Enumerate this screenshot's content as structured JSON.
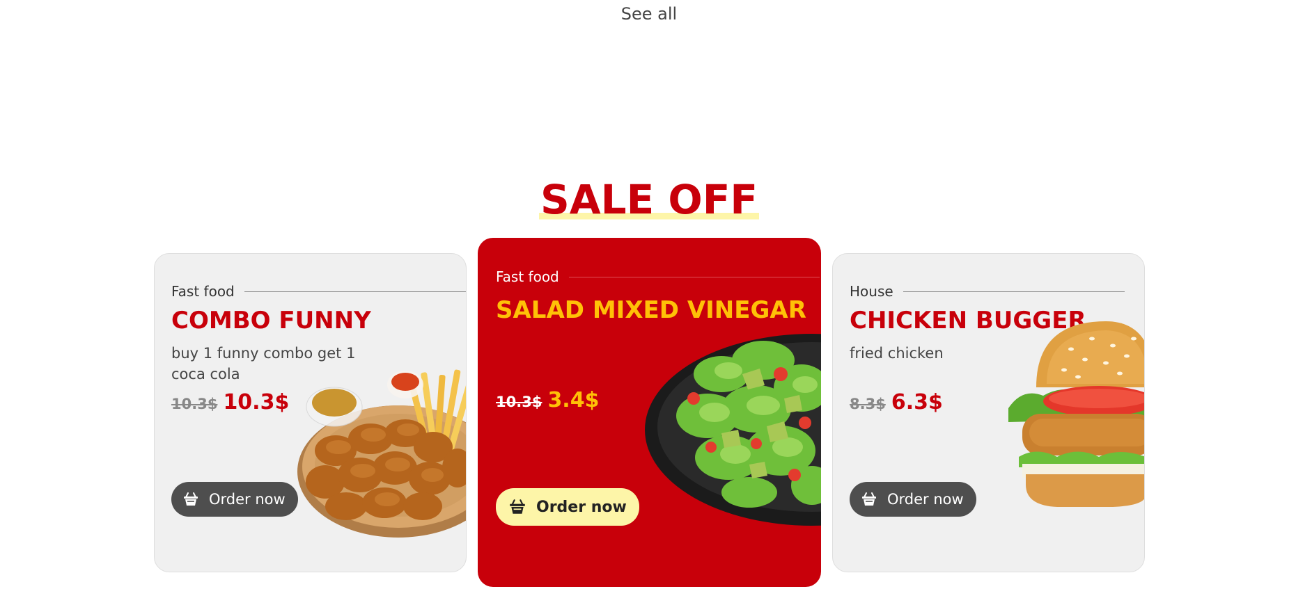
{
  "see_all_label": "See all",
  "section_title": "SALE OFF",
  "order_label": "Order now",
  "colors": {
    "brand_red": "#c8000a",
    "accent_yellow": "#ffc107",
    "highlight_yellow": "#fdf5a8",
    "card_grey": "#f0f0f0",
    "button_dark": "#4e4e4e"
  },
  "cards": [
    {
      "category": "Fast food",
      "title": "COMBO FUNNY",
      "description": "buy 1 funny combo get 1 coca cola",
      "old_price": "10.3$",
      "new_price": "10.3$",
      "icon": "basket-icon"
    },
    {
      "category": "Fast food",
      "title": "SALAD MIXED VINEGAR",
      "description": "",
      "old_price": "10.3$",
      "new_price": "3.4$",
      "icon": "basket-icon"
    },
    {
      "category": "House",
      "title": "CHICKEN BUGGER",
      "description": "fried chicken",
      "old_price": "8.3$",
      "new_price": "6.3$",
      "icon": "basket-icon"
    }
  ]
}
